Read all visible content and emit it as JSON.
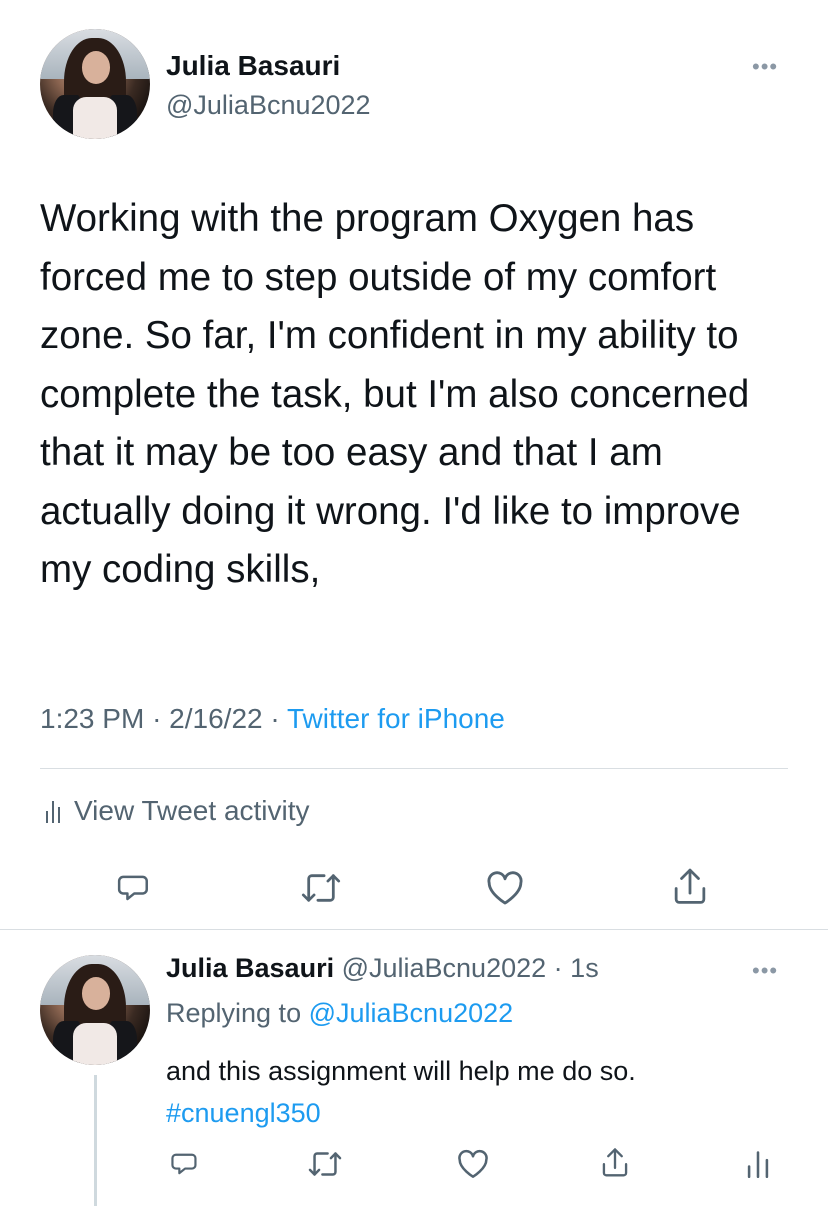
{
  "tweet": {
    "author_name": "Julia Basauri",
    "author_handle": "@JuliaBcnu2022",
    "more_label": "•••",
    "text": "Working with the program Oxygen has forced me to step outside of my comfort zone. So far, I'm confident in my ability to complete the task, but I'm also concerned that it may be too easy and that I am actually doing it wrong. I'd like to improve my coding skills,",
    "time": "1:23 PM",
    "date": "2/16/22",
    "separator": "·",
    "source": "Twitter for iPhone",
    "activity_label": "View Tweet activity"
  },
  "reply": {
    "author_name": "Julia Basauri",
    "author_handle": "@JuliaBcnu2022",
    "separator": "·",
    "age": "1s",
    "more_label": "•••",
    "replying_prefix": "Replying to",
    "replying_handle": "@JuliaBcnu2022",
    "text": "and this assignment will help me do so.",
    "hashtag": "#cnuengl350"
  },
  "icons": {
    "reply": "reply-icon",
    "retweet": "retweet-icon",
    "like": "like-icon",
    "share": "share-icon",
    "analytics": "analytics-icon"
  },
  "colors": {
    "link_blue": "#1d9bf0",
    "secondary_text": "#536471",
    "primary_text": "#0f1419",
    "divider": "#d9dee2"
  }
}
